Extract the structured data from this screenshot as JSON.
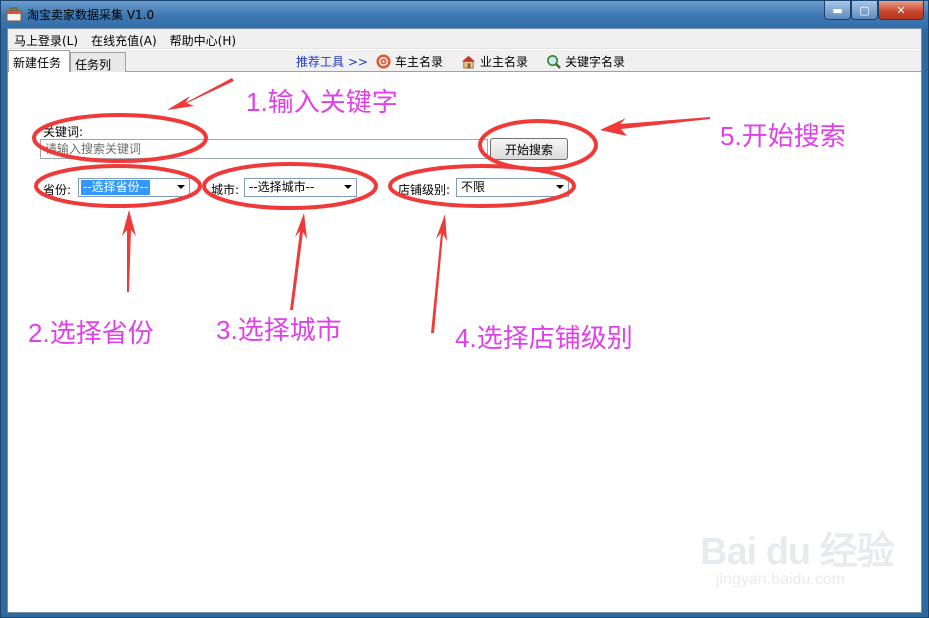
{
  "window": {
    "title": "淘宝卖家数据采集 V1.0",
    "controls": {
      "minimize": "▬",
      "maximize": "▢",
      "close": "✕"
    }
  },
  "menu": [
    "马上登录(L)",
    "在线充值(A)",
    "帮助中心(H)"
  ],
  "tabs": [
    "新建任务",
    "任务列表"
  ],
  "toolbar": {
    "recommend_label": "推荐工具 >>",
    "tools": [
      {
        "label": "车主名录",
        "icon": "car-icon"
      },
      {
        "label": "业主名录",
        "icon": "house-icon"
      },
      {
        "label": "关键字名录",
        "icon": "magnifier-icon"
      }
    ]
  },
  "form": {
    "keyword_label": "关键词:",
    "keyword_placeholder": "请输入搜索关键词",
    "search_button": "开始搜索",
    "province_label": "省份:",
    "province_value": "--选择省份--",
    "city_label": "城市:",
    "city_value": "--选择城市--",
    "shop_level_label": "店铺级别:",
    "shop_level_value": "不限"
  },
  "annotations": {
    "step1": {
      "num": "1.",
      "text": "输入关键字"
    },
    "step2": {
      "num": "2.",
      "text": "选择省份"
    },
    "step3": {
      "num": "3.",
      "text": "选择城市"
    },
    "step4": {
      "num": "4.",
      "text": "选择店铺级别"
    },
    "step5": {
      "num": "5.",
      "text": "开始搜索"
    },
    "color": "#e040e8",
    "mark_color": "#f03a3a"
  },
  "watermark": {
    "logo": "Bai du 经验",
    "url": "jingyan.baidu.com"
  }
}
